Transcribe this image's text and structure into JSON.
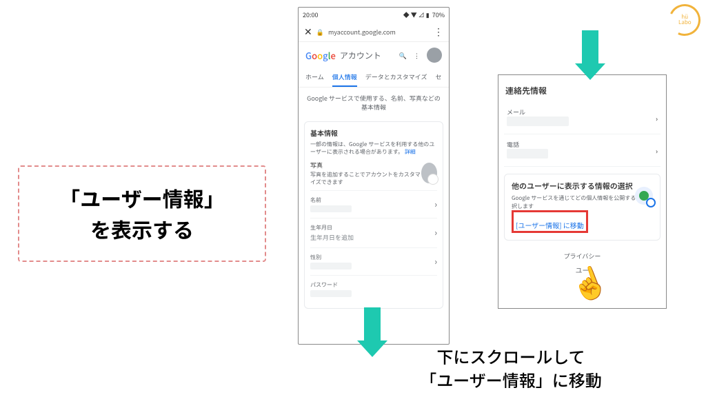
{
  "instruction": {
    "line1": "「ユーザー情報」",
    "line2": "を表示する"
  },
  "caption": {
    "line1": "下にスクロールして",
    "line2": "「ユーザー情報」に移動"
  },
  "phone": {
    "status": {
      "time": "20:00",
      "net": "⋈",
      "battery": "70%",
      "icons": "◆ ▼ ⊿ ▮"
    },
    "urlbar": {
      "close": "✕",
      "lock": "🔒",
      "url": "myaccount.google.com",
      "menu": "⋮"
    },
    "header": {
      "google": {
        "g1": "G",
        "g2": "o",
        "g3": "o",
        "g4": "g",
        "g5": "l",
        "g6": "e"
      },
      "title": "アカウント",
      "search": "🔍",
      "menu": "⋮"
    },
    "tabs": {
      "home": "ホーム",
      "personal": "個人情報",
      "data": "データとカスタマイズ",
      "sec": "セ"
    },
    "intro": "Google サービスで使用する、名前、写真などの基本情報",
    "basic": {
      "title": "基本情報",
      "sub": "一部の情報は、Google サービスを利用する他のユーザーに表示される場合があります。",
      "sub_link": "詳細",
      "photo_label": "写真",
      "photo_sub": "写真を追加することでアカウントをカスタマイズできます",
      "name_label": "名前",
      "dob_label": "生年月日",
      "dob_value": "生年月日を追加",
      "gender_label": "性別",
      "password_label": "パスワード"
    }
  },
  "panel": {
    "title": "連絡先情報",
    "email_label": "メール",
    "phone_label": "電話",
    "card": {
      "title": "他のユーザーに表示する情報の選択",
      "sub": "Google サービスを通じてどの個人情報を公開するかを選択します",
      "goto": "[ユーザー情報] に移動"
    },
    "privacy": "プライバシー",
    "cut": "ユー"
  },
  "brand": {
    "l1": "hü",
    "l2": "Labo"
  }
}
